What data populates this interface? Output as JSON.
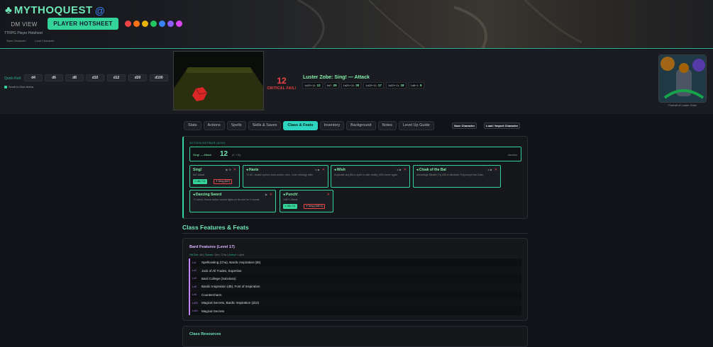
{
  "app": {
    "logo_text": "MYTHOQUEST",
    "subtitle": "TTRPG Player Hotsheet",
    "save_link": "Save Character",
    "load_link": "Load Character"
  },
  "modes": {
    "dm_view": "DM VIEW",
    "player_hotsheet": "PLAYER HOTSHEET"
  },
  "theme_colors": [
    "#ef4444",
    "#f97316",
    "#eab308",
    "#22c55e",
    "#3b82f6",
    "#8b5cf6",
    "#d946ef"
  ],
  "quick_roll": {
    "label": "Quick Roll:",
    "dice": [
      "d4",
      "d6",
      "d8",
      "d10",
      "d12",
      "d20",
      "d100"
    ],
    "scroll_label": "Scroll to Dice Arena"
  },
  "roll": {
    "total": "12",
    "status": "CRITICAL FAIL!",
    "title": "Luster Zobe: Sing! — Attack",
    "history": [
      {
        "expr": "1d20+11:",
        "val": "12"
      },
      {
        "expr": "6d7:",
        "val": "29"
      },
      {
        "expr": "1d20+11:",
        "val": "30"
      },
      {
        "expr": "1d20+11:",
        "val": "17"
      },
      {
        "expr": "1d20+11:",
        "val": "18"
      },
      {
        "expr": "1d8+1:",
        "val": "9"
      }
    ]
  },
  "portrait": {
    "caption": "Portrait of Luster Zobe"
  },
  "tabs": [
    "Stats",
    "Actions",
    "Spells",
    "Skills & Saves",
    "Class & Feats",
    "Inventory",
    "Background",
    "Notes",
    "Level Up Guide"
  ],
  "active_tab": "Class & Feats",
  "toolbar": {
    "save": "Save Character",
    "load": "Load / Import Character"
  },
  "hotbar": {
    "label": "ACTION HOTBAR (6/10)",
    "summary_label": "Sing! — Attack",
    "summary_total": "12",
    "summary_breakdown": "(1 +11)",
    "dismiss": "dismiss",
    "cards": [
      {
        "name": "Sing!",
        "desc": "6d7 Attack",
        "atk": "⚔ Atk +11",
        "dmg": "✦ Dmg (6d7)",
        "ctrl": "▶ ⚙"
      },
      {
        "name": "◂ Haste",
        "desc": "+2 AC, double speed, extra action; conc. 1min; lethargy after",
        "ctrl": "▸ ▶"
      },
      {
        "name": "◂ Wish",
        "desc": "Duplicate any 8th-lv spell or alter reality; 33% never again",
        "ctrl": "▸ ▶"
      },
      {
        "name": "◂ Cloak of the Bat",
        "desc": "Advantage Stealth; Fly 40ft in dim/dark; Polymorph bat 1/day",
        "ctrl": "▸ ▶"
      },
      {
        "name": "◂ Dancing Sword",
        "desc": "+1 sword. Bonus action: sword fights on its own for 4 rounds",
        "ctrl": "▶"
      },
      {
        "name": "◂ Punch!",
        "desc": "1d8+1 Attack",
        "atk": "⚔ Atk +11",
        "dmg": "✦ Dmg (1d8+1)",
        "ctrl": ""
      }
    ]
  },
  "class_features": {
    "heading": "Class Features & Feats",
    "box_title": "Bard Features (Level 17)",
    "stats": {
      "hd_label": "Hit Die:",
      "hd": "d8",
      "saves_label": "Saves:",
      "saves": "Dex, Cha",
      "armor_label": "Armor:",
      "armor": "Light"
    },
    "features": [
      {
        "lv": "Lv1",
        "text": "Spellcasting (Cha), Bardic Inspiration (d6)"
      },
      {
        "lv": "Lv2",
        "text": "Jack of All Trades, Expertise"
      },
      {
        "lv": "Lv3",
        "text": "Bard College (Subclass)"
      },
      {
        "lv": "Lv5",
        "text": "Bardic Inspiration (d8), Font of Inspiration"
      },
      {
        "lv": "Lv6",
        "text": "Countercharm"
      },
      {
        "lv": "Lv10",
        "text": "Magical Secrets, Bardic Inspiration (d10)"
      },
      {
        "lv": "Lv14",
        "text": "Magical Secrets"
      }
    ]
  },
  "class_resources": {
    "title": "Class Resources"
  }
}
